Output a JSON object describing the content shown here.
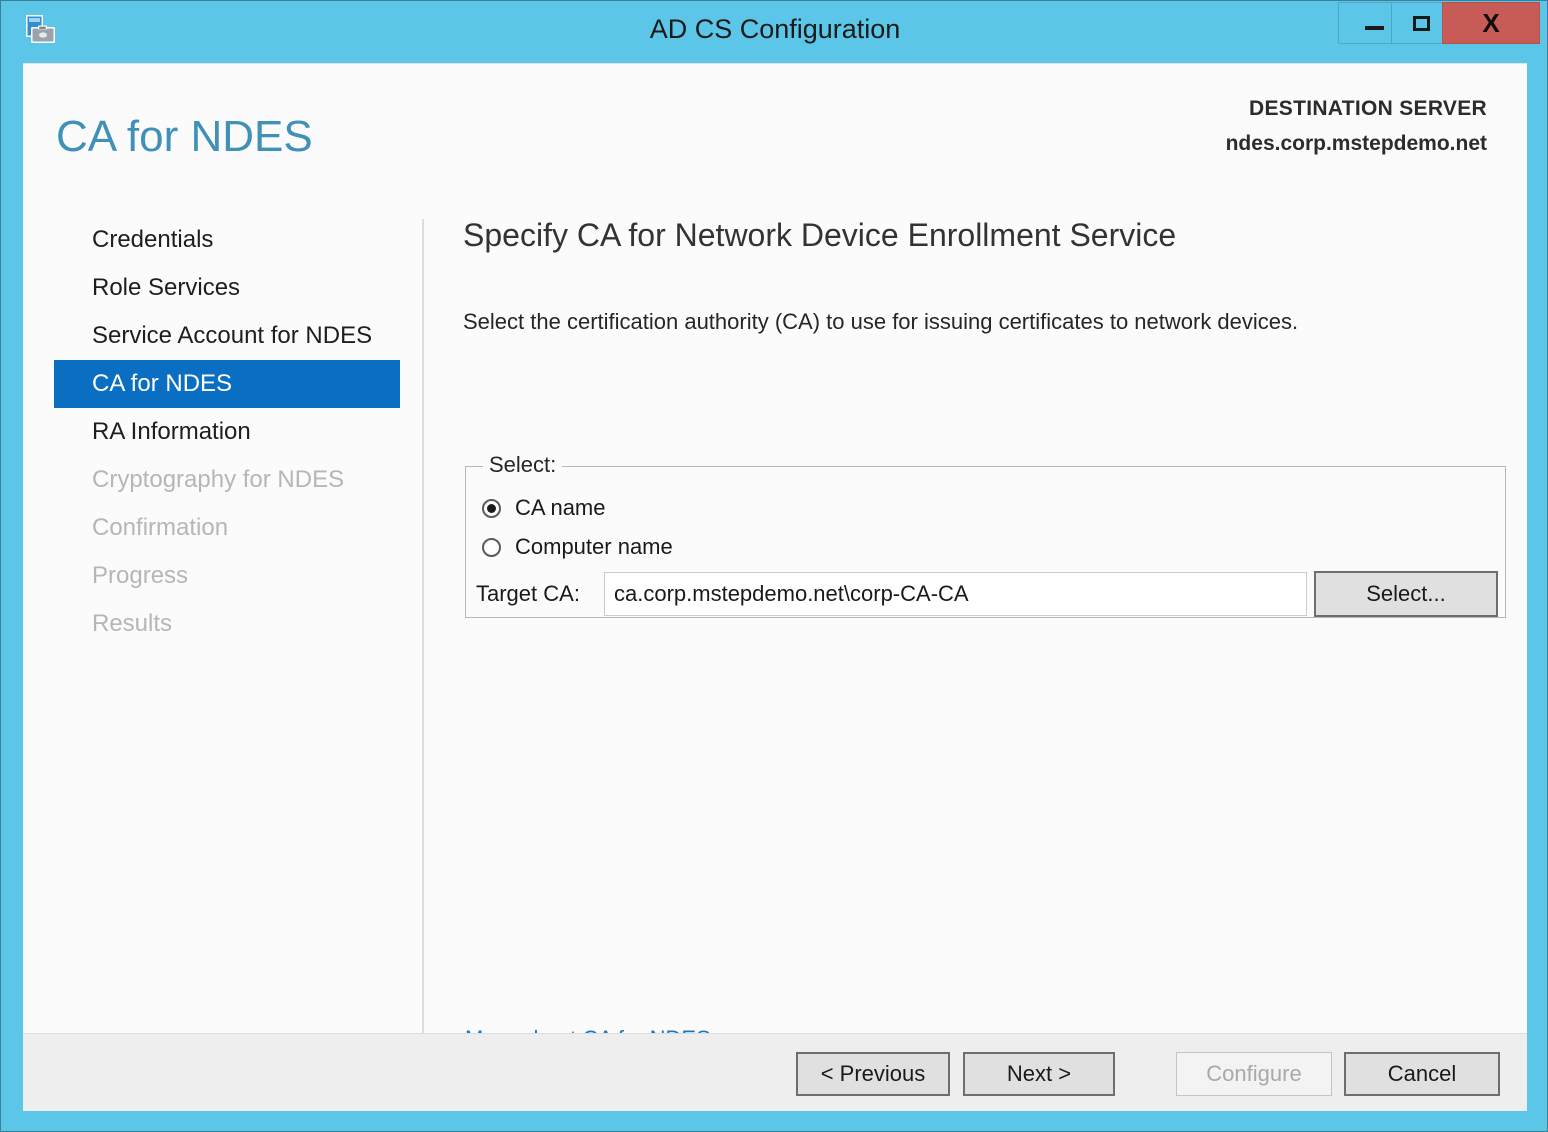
{
  "window": {
    "title": "AD CS Configuration",
    "app_icon": "server-manager-icon",
    "controls": {
      "minimize": "minimize-icon",
      "maximize": "maximize-icon",
      "close": "X"
    },
    "colors": {
      "titlebar": "#5BC6E8",
      "close_button": "#c75b57",
      "accent_heading": "#3f91b8",
      "nav_active": "#0a6fc2",
      "link": "#1479c6"
    }
  },
  "header": {
    "page_title": "CA for NDES",
    "destination_label": "DESTINATION SERVER",
    "destination_server": "ndes.corp.mstepdemo.net"
  },
  "sidebar": {
    "items": [
      {
        "label": "Credentials",
        "state": "normal"
      },
      {
        "label": "Role Services",
        "state": "normal"
      },
      {
        "label": "Service Account for NDES",
        "state": "normal"
      },
      {
        "label": "CA for NDES",
        "state": "active"
      },
      {
        "label": "RA Information",
        "state": "normal"
      },
      {
        "label": "Cryptography for NDES",
        "state": "disabled"
      },
      {
        "label": "Confirmation",
        "state": "disabled"
      },
      {
        "label": "Progress",
        "state": "disabled"
      },
      {
        "label": "Results",
        "state": "disabled"
      }
    ]
  },
  "main": {
    "section_title": "Specify CA for Network Device Enrollment Service",
    "description": "Select the certification authority (CA) to use for issuing certificates to network devices.",
    "group": {
      "legend": "Select:",
      "radios": [
        {
          "label": "CA name",
          "checked": true
        },
        {
          "label": "Computer name",
          "checked": false
        }
      ],
      "target_label": "Target CA:",
      "target_value": "ca.corp.mstepdemo.net\\corp-CA-CA",
      "target_placeholder": "",
      "select_button": "Select..."
    },
    "more_link": "More about CA for NDES"
  },
  "footer": {
    "previous": "< Previous",
    "next": "Next >",
    "configure": "Configure",
    "cancel": "Cancel",
    "configure_enabled": false
  }
}
